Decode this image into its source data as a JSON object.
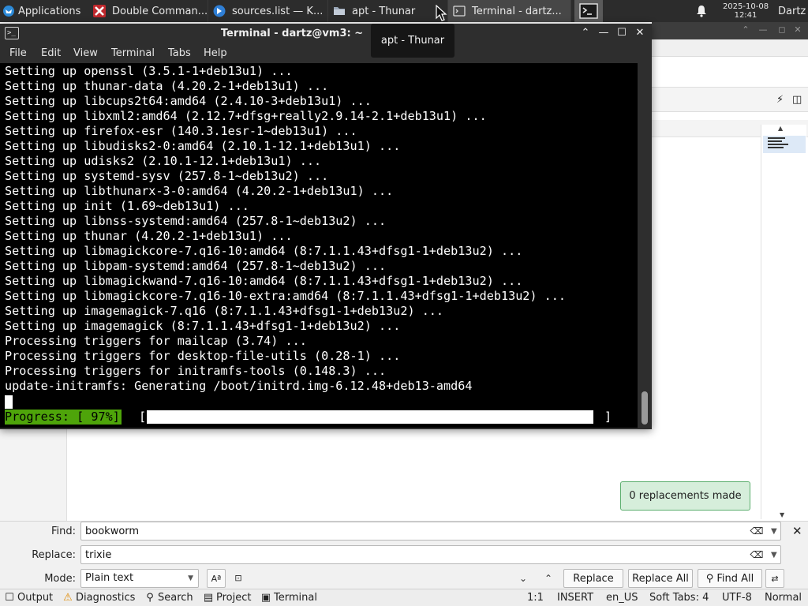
{
  "taskbar": {
    "applications_label": "Applications",
    "tasks": [
      {
        "label": "Double Comman...",
        "icon": "double-commander-icon"
      },
      {
        "label": "sources.list — K...",
        "icon": "kate-icon"
      },
      {
        "label": "apt - Thunar",
        "icon": "folder-icon"
      },
      {
        "label": "Terminal - dartz...",
        "icon": "terminal-icon"
      }
    ],
    "tray_icon": "terminal-icon",
    "notification_icon": "bell-icon",
    "clock_date": "2025-10-08",
    "clock_time": "12:41",
    "user": "Dartz"
  },
  "terminal": {
    "title": "Terminal - dartz@vm3: ~",
    "menu": [
      "File",
      "Edit",
      "View",
      "Terminal",
      "Tabs",
      "Help"
    ],
    "lines": [
      "Setting up openssl (3.5.1-1+deb13u1) ...",
      "Setting up thunar-data (4.20.2-1+deb13u1) ...",
      "Setting up libcups2t64:amd64 (2.4.10-3+deb13u1) ...",
      "Setting up libxml2:amd64 (2.12.7+dfsg+really2.9.14-2.1+deb13u1) ...",
      "Setting up firefox-esr (140.3.1esr-1~deb13u1) ...",
      "Setting up libudisks2-0:amd64 (2.10.1-12.1+deb13u1) ...",
      "Setting up udisks2 (2.10.1-12.1+deb13u1) ...",
      "Setting up systemd-sysv (257.8-1~deb13u2) ...",
      "Setting up libthunarx-3-0:amd64 (4.20.2-1+deb13u1) ...",
      "Setting up init (1.69~deb13u1) ...",
      "Setting up libnss-systemd:amd64 (257.8-1~deb13u2) ...",
      "Setting up thunar (4.20.2-1+deb13u1) ...",
      "Setting up libmagickcore-7.q16-10:amd64 (8:7.1.1.43+dfsg1-1+deb13u2) ...",
      "Setting up libpam-systemd:amd64 (257.8-1~deb13u2) ...",
      "Setting up libmagickwand-7.q16-10:amd64 (8:7.1.1.43+dfsg1-1+deb13u2) ...",
      "Setting up libmagickcore-7.q16-10-extra:amd64 (8:7.1.1.43+dfsg1-1+deb13u2) ...",
      "Setting up imagemagick-7.q16 (8:7.1.1.43+dfsg1-1+deb13u2) ...",
      "Setting up imagemagick (8:7.1.1.43+dfsg1-1+deb13u2) ...",
      "Processing triggers for mailcap (3.74) ...",
      "Processing triggers for desktop-file-utils (0.28-1) ...",
      "Processing triggers for initramfs-tools (0.148.3) ...",
      "update-initramfs: Generating /boot/initrd.img-6.12.48+deb13-amd64"
    ],
    "progress_label": "Progress: [ 97%]",
    "progress_open": "[",
    "progress_close": "]",
    "progress_fraction": 0.97,
    "progress_color": "#4ea40a"
  },
  "tooltip": "apt - Thunar",
  "editor": {
    "notice": "0 replacements made",
    "find": {
      "find_label": "Find:",
      "find_value": "bookworm",
      "replace_label": "Replace:",
      "replace_value": "trixie",
      "mode_label": "Mode:",
      "mode_value": "Plain text",
      "replace_button": "Replace",
      "replace_all_button": "Replace All",
      "find_all_button": "Find All"
    },
    "statusbar": {
      "output": "Output",
      "diagnostics": "Diagnostics",
      "search": "Search",
      "project": "Project",
      "terminal": "Terminal",
      "position": "1:1",
      "mode": "INSERT",
      "language": "en_US",
      "tabs": "Soft Tabs: 4",
      "encoding": "UTF-8",
      "input_mode": "Normal"
    }
  }
}
